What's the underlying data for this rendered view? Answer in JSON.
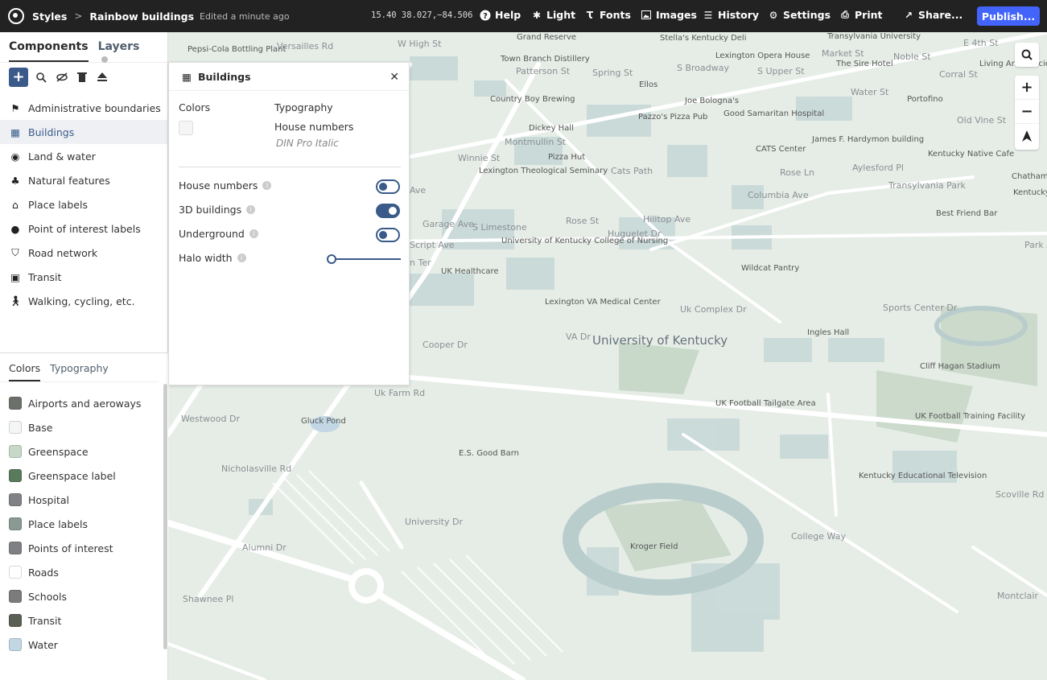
{
  "topbar": {
    "crumbs": [
      "Styles",
      "Rainbow buildings"
    ],
    "edited": "Edited a minute ago",
    "coords": "15.40 38.027,−84.506",
    "buttons": {
      "help": "Help",
      "light": "Light",
      "fonts": "Fonts",
      "images": "Images",
      "history": "History",
      "settings": "Settings",
      "print": "Print",
      "share": "Share..."
    },
    "publish": "Publish..."
  },
  "sidebar": {
    "tabs": {
      "components": "Components",
      "layers": "Layers"
    },
    "components": [
      {
        "label": "Administrative boundaries",
        "icon": "flag-icon"
      },
      {
        "label": "Buildings",
        "icon": "building-icon"
      },
      {
        "label": "Land & water",
        "icon": "globe-icon"
      },
      {
        "label": "Natural features",
        "icon": "tree-icon"
      },
      {
        "label": "Place labels",
        "icon": "place-icon"
      },
      {
        "label": "Point of interest labels",
        "icon": "pin-icon"
      },
      {
        "label": "Road network",
        "icon": "road-icon"
      },
      {
        "label": "Transit",
        "icon": "train-icon"
      },
      {
        "label": "Walking, cycling, etc.",
        "icon": "walk-icon"
      }
    ],
    "bottom_tabs": {
      "colors": "Colors",
      "typography": "Typography"
    },
    "colors": [
      {
        "label": "Airports and aeroways",
        "color": "#6b7069"
      },
      {
        "label": "Base",
        "color": "#f4f6f5"
      },
      {
        "label": "Greenspace",
        "color": "#c8d8c8"
      },
      {
        "label": "Greenspace label",
        "color": "#5a7a5c"
      },
      {
        "label": "Hospital",
        "color": "#808288"
      },
      {
        "label": "Place labels",
        "color": "#8a9a92"
      },
      {
        "label": "Points of interest",
        "color": "#7f8084"
      },
      {
        "label": "Roads",
        "color": "#ffffff"
      },
      {
        "label": "Schools",
        "color": "#7b7b7b"
      },
      {
        "label": "Transit",
        "color": "#5a6055"
      },
      {
        "label": "Water",
        "color": "#c2d6e4"
      }
    ]
  },
  "panel": {
    "title": "Buildings",
    "colors_label": "Colors",
    "typography_label": "Typography",
    "house_numbers_label": "House numbers",
    "font": "DIN Pro Italic",
    "options": [
      {
        "label": "House numbers",
        "type": "toggle",
        "on": false
      },
      {
        "label": "3D buildings",
        "type": "toggle",
        "on": true
      },
      {
        "label": "Underground",
        "type": "toggle",
        "on": false
      },
      {
        "label": "Halo width",
        "type": "slider",
        "value": 0
      }
    ]
  },
  "map": {
    "labels": [
      "Pepsi-Cola Bottling Plant",
      "Versailles Rd",
      "W High St",
      "Grand Reserve",
      "Stella's Kentucky Deli",
      "Transylvania University",
      "E 4th St",
      "Lexington Opera House",
      "Town Branch Distillery",
      "Market St",
      "The Sire Hotel",
      "Noble St",
      "Living Arts & Science Center",
      "S Broadway",
      "S Upper St",
      "Corral St",
      "Patterson St",
      "Spring St",
      "Ellos",
      "Water St",
      "Portofino",
      "Country Boy Brewing",
      "Joe Bologna's",
      "Pazzo's Pizza Pub",
      "Good Samaritan Hospital",
      "Old Vine St",
      "Dickey Hall",
      "Montmullin St",
      "CATS Center",
      "James F. Hardymon building",
      "Pizza Hut",
      "Lexington Theological Seminary",
      "Winnie St",
      "Cats Path",
      "Rose Ln",
      "Aylesford Pl",
      "Kentucky Native Cafe",
      "Chatham's",
      "Transylvania Park",
      "Columbia Ave",
      "Best Friend Bar",
      "Kentucky",
      "Park A",
      "S Limestone",
      "Rose St",
      "Hilltop Ave",
      "Huguelet Dr",
      "University of Kentucky College of Nursing",
      "Wildcat Pantry",
      "UK Healthcare",
      "Lexington VA Medical Center",
      "University of Kentucky",
      "Uk Complex Dr",
      "Sports Center Dr",
      "Ingles Hall",
      "Cooper Dr",
      "VA Dr",
      "Cliff Hagan Stadium",
      "UK Football Tailgate Area",
      "UK Football Training Facility",
      "Westwood Dr",
      "Gluck Pond",
      "E.S. Good Barn",
      "Nicholasville Rd",
      "Kentucky Educational Television",
      "Scoville Rd",
      "Kroger Field",
      "College Way",
      "Alumni Dr",
      "University Dr",
      "Montclair",
      "Shawnee Pl",
      "Uk Farm Rd",
      "Garage Ave",
      "Script Ave",
      "n Ter",
      "Ave"
    ]
  }
}
